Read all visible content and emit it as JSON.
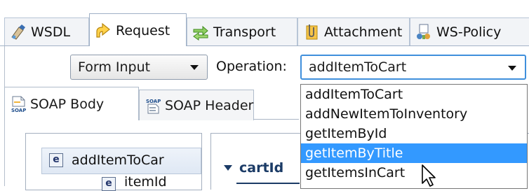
{
  "tabs": [
    {
      "label": "WSDL",
      "icon": "wsdl-icon"
    },
    {
      "label": "Request",
      "icon": "request-arrow-icon",
      "active": true
    },
    {
      "label": "Transport",
      "icon": "transport-arrows-icon"
    },
    {
      "label": "Attachment",
      "icon": "attachment-clip-icon"
    },
    {
      "label": "WS-Policy",
      "icon": "ws-policy-icon"
    }
  ],
  "toolbar": {
    "view_mode": "Form Input",
    "operation_label": "Operation:",
    "operation_value": "addItemToCart"
  },
  "operation_options": [
    "addItemToCart",
    "addNewItemToInventory",
    "getItemById",
    "getItemByTitle",
    "getItemsInCart"
  ],
  "highlighted_option": "getItemByTitle",
  "subtabs": [
    {
      "label": "SOAP Body",
      "icon": "soap-body-icon",
      "active": true
    },
    {
      "label": "SOAP Header",
      "icon": "soap-header-icon"
    }
  ],
  "tree": {
    "items": [
      {
        "label": "addItemToCar",
        "badge": "e"
      },
      {
        "label": "itemId",
        "badge": "e"
      }
    ]
  },
  "form": {
    "section_title": "cartId"
  },
  "colors": {
    "selection": "#3399ff",
    "focus_border": "#3f8fdc",
    "section_text": "#1b3b66"
  }
}
